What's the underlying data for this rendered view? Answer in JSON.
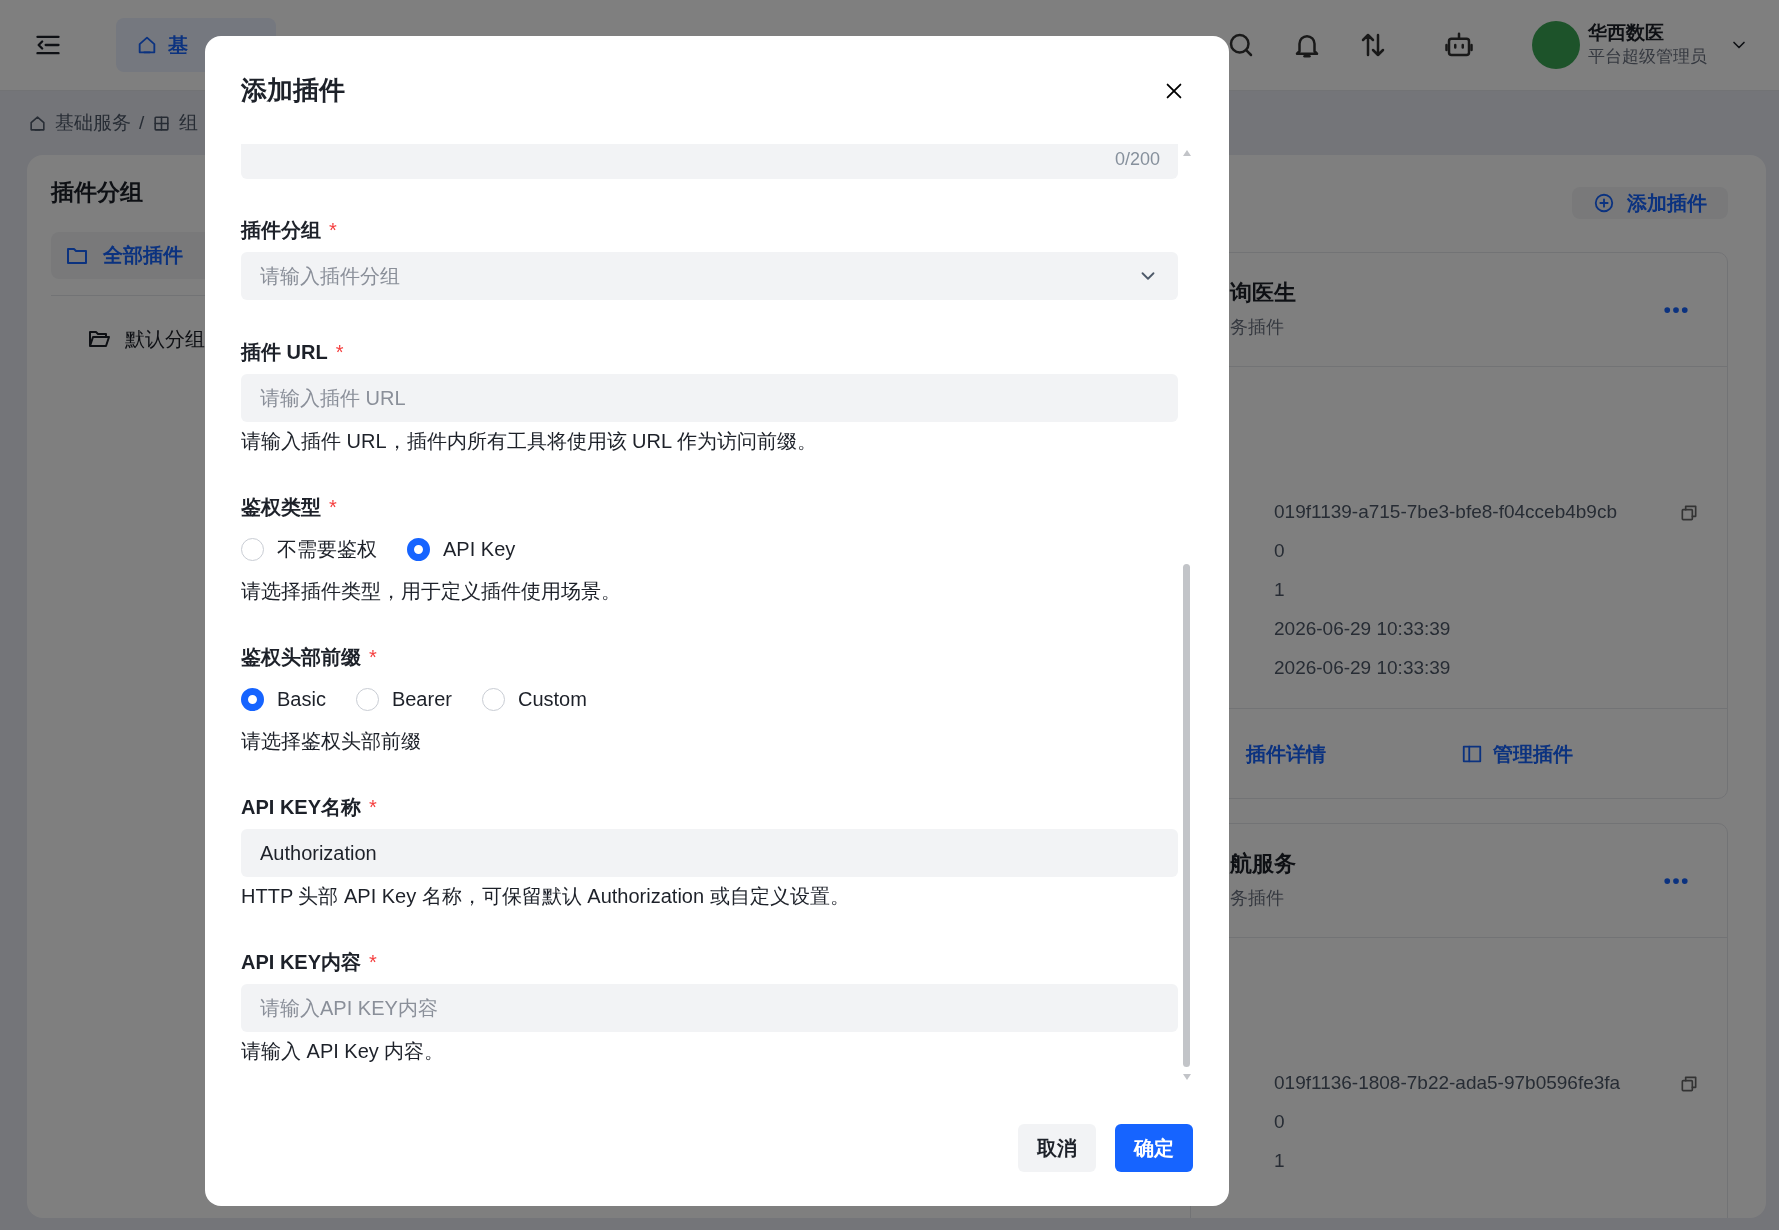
{
  "header": {
    "tab": {
      "label": "基",
      "selected": true
    },
    "user": {
      "name": "华西数医",
      "role": "平台超级管理员"
    }
  },
  "breadcrumb": {
    "items": [
      "基础服务",
      "组"
    ],
    "separator": "/"
  },
  "sidebar": {
    "title": "插件分组",
    "items": [
      {
        "label": "全部插件",
        "selected": true
      },
      {
        "label": "默认分组",
        "selected": false
      }
    ]
  },
  "toolbar": {
    "add_button": "添加插件"
  },
  "plugin_cards": [
    {
      "title": "询医生",
      "subtitle": "务插件",
      "fields": [
        "019f1139-a715-7be3-bfe8-f04cceb4b9cb",
        "0",
        "1",
        "2026-06-29 10:33:39",
        "2026-06-29 10:33:39"
      ],
      "actions": [
        "插件详情",
        "管理插件"
      ]
    },
    {
      "title": "航服务",
      "subtitle": "务插件",
      "fields": [
        "019f1136-1808-7b22-ada5-97b0596fe3fa",
        "0",
        "1"
      ]
    }
  ],
  "dialog": {
    "title": "添加插件",
    "counter": "0/200",
    "required_mark": "*",
    "fields": [
      {
        "kind": "select",
        "label": "插件分组",
        "required": true,
        "placeholder": "请输入插件分组"
      },
      {
        "kind": "input",
        "label": "插件 URL",
        "required": true,
        "placeholder": "请输入插件 URL",
        "help": "请输入插件 URL，插件内所有工具将使用该 URL 作为访问前缀。"
      },
      {
        "kind": "radio",
        "label": "鉴权类型",
        "required": true,
        "options": [
          {
            "label": "不需要鉴权",
            "selected": false
          },
          {
            "label": "API Key",
            "selected": true
          }
        ],
        "help": "请选择插件类型，用于定义插件使用场景。"
      },
      {
        "kind": "radio",
        "label": "鉴权头部前缀",
        "required": true,
        "options": [
          {
            "label": "Basic",
            "selected": true
          },
          {
            "label": "Bearer",
            "selected": false
          },
          {
            "label": "Custom",
            "selected": false
          }
        ],
        "help": "请选择鉴权头部前缀"
      },
      {
        "kind": "input",
        "label": "API KEY名称",
        "required": true,
        "value": "Authorization",
        "help": "HTTP 头部 API Key 名称，可保留默认 Authorization 或自定义设置。"
      },
      {
        "kind": "input",
        "label": "API KEY内容",
        "required": true,
        "placeholder": "请输入API KEY内容",
        "help": "请输入 API Key 内容。"
      }
    ],
    "buttons": [
      {
        "label": "取消",
        "kind": "secondary"
      },
      {
        "label": "确定",
        "kind": "primary"
      }
    ]
  }
}
